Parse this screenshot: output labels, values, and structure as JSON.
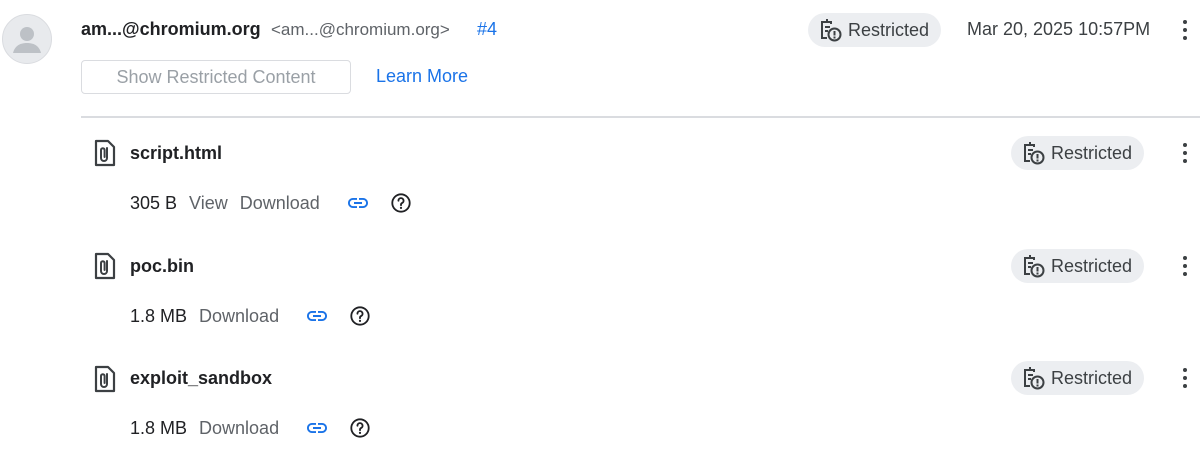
{
  "header": {
    "author": "am...@chromium.org",
    "author_email": "<am...@chromium.org>",
    "comment_number": "#4",
    "status": "Restricted",
    "timestamp": "Mar 20, 2025 10:57PM"
  },
  "actions": {
    "show_restricted": "Show Restricted Content",
    "learn_more": "Learn More"
  },
  "attachments": [
    {
      "name": "script.html",
      "size": "305 B",
      "links": [
        "View",
        "Download"
      ],
      "status": "Restricted"
    },
    {
      "name": "poc.bin",
      "size": "1.8 MB",
      "links": [
        "Download"
      ],
      "status": "Restricted"
    },
    {
      "name": "exploit_sandbox",
      "size": "1.8 MB",
      "links": [
        "Download"
      ],
      "status": "Restricted"
    }
  ],
  "icons": {
    "avatar": "person-avatar-icon",
    "restricted": "restricted-icon",
    "attachment": "paperclip-file-icon",
    "link": "link-icon",
    "help": "help-circle-icon",
    "menu": "more-vert-icon"
  },
  "colors": {
    "accent": "#1a73e8",
    "chip_bg": "#eceef1",
    "text_primary": "#202124",
    "text_secondary": "#5f6368",
    "divider": "#dadce0"
  }
}
